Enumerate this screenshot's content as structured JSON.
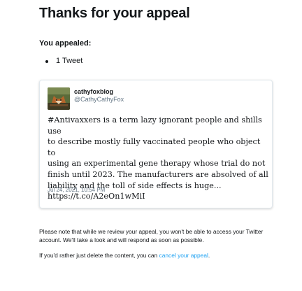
{
  "header": {
    "title": "Thanks for your appeal"
  },
  "appeal": {
    "label": "You appealed:",
    "items": [
      "1 Tweet"
    ]
  },
  "tweet": {
    "display_name": "cathyfoxblog",
    "handle": "@CathyCathyFox",
    "text_lines": [
      "#Antivaxxers is a term lazy ignorant people and shills use",
      "to describe mostly fully vaccinated people who object to",
      "using an experimental gene therapy whose trial do not",
      "finish until 2023. The manufacturers are absolved of all",
      "liability and the toll of side effects is huge...",
      "https://t.co/A2eOn1wMiI"
    ],
    "timestamp": "Jul 24, 2021, 10:54 PM"
  },
  "notice": {
    "line1": "Please note that while we review your appeal, you won't be able to access your Twitter",
    "line2": "account. We'll take a look and will respond as soon as possible.",
    "delete_prefix": "If you'd rather just delete the content, you can ",
    "cancel_link": "cancel your appeal",
    "delete_suffix": "."
  },
  "colors": {
    "link": "#1da1f2",
    "secondary_text": "#657786",
    "card_border": "#e1e8ed"
  }
}
